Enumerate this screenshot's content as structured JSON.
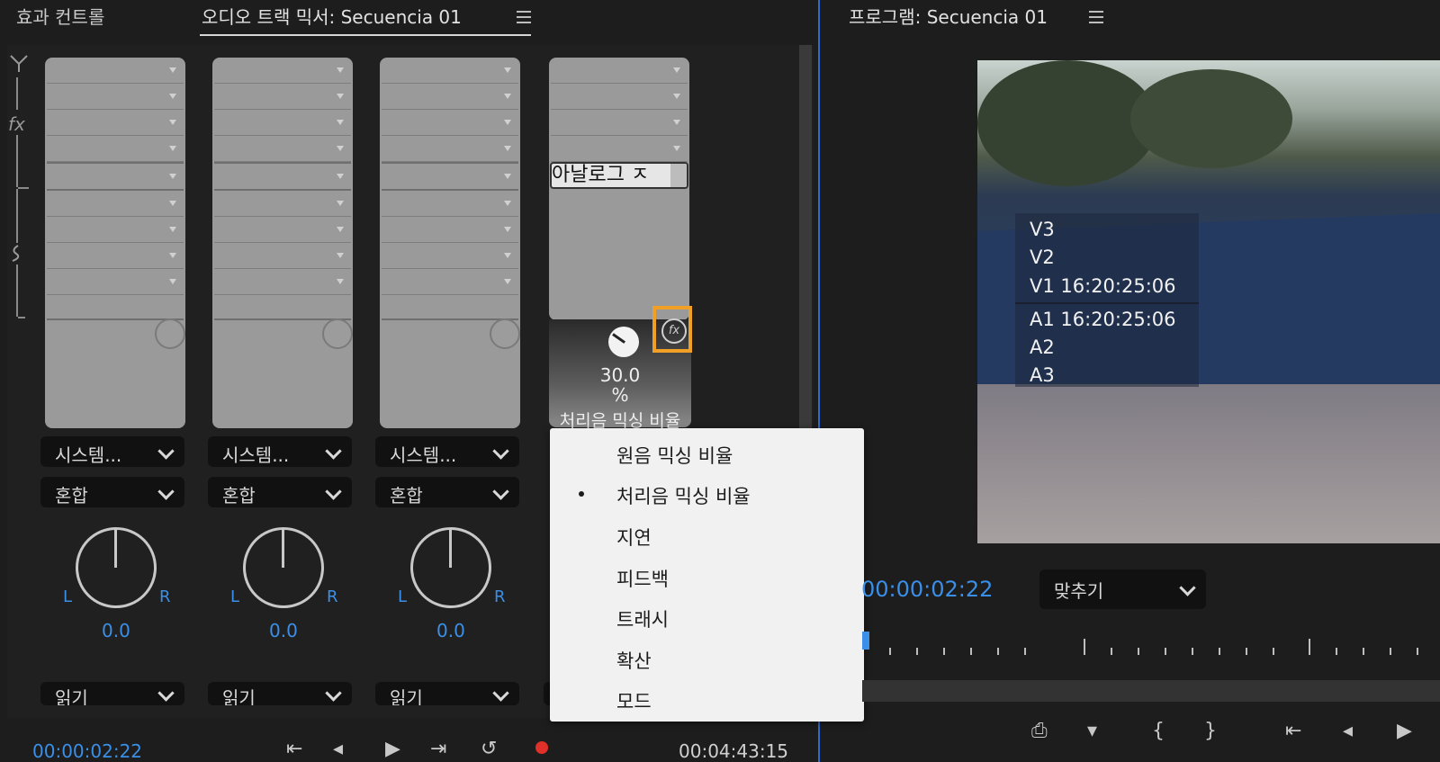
{
  "left_panel": {
    "tabs": [
      {
        "label": "효과 컨트롤"
      },
      {
        "label": "오디오 트랙 믹서: Secuencia 01"
      }
    ],
    "rail_labels": {
      "fx": "fx"
    },
    "tracks": [
      {
        "output": "시스템...",
        "mode": "혼합",
        "pan_l": "L",
        "pan_r": "R",
        "pan_value": "0.0",
        "automation": "읽기"
      },
      {
        "output": "시스템...",
        "mode": "혼합",
        "pan_l": "L",
        "pan_r": "R",
        "pan_value": "0.0",
        "automation": "읽기"
      },
      {
        "output": "시스템...",
        "mode": "혼합",
        "pan_l": "L",
        "pan_r": "R",
        "pan_value": "0.0",
        "automation": "읽기"
      }
    ],
    "effect_lane": {
      "effect_name": "아날로그 ㅈ",
      "param_value": "30.0",
      "param_unit": "%",
      "param_name": "처리음 믹싱 비율",
      "fx_badge": "fx"
    },
    "context_menu": {
      "items": [
        "원음 믹싱 비율",
        "처리음 믹싱 비율",
        "지연",
        "피드백",
        "트래시",
        "확산",
        "모드"
      ],
      "selected_index": 1
    },
    "bottom": {
      "timecode_left": "00:00:02:22",
      "timecode_right": "00:04:43:15"
    }
  },
  "program_monitor": {
    "title": "프로그램: Secuencia 01",
    "overlay_lines": [
      "V3",
      "V2",
      "V1 16:20:25:06",
      "A1 16:20:25:06",
      "A2",
      "A3"
    ],
    "timecode": "00:00:02:22",
    "fit_dropdown": "맞추기"
  },
  "colors": {
    "accent_blue": "#3a8fe8",
    "highlight_orange": "#f0a027",
    "record_red": "#e0302a"
  }
}
